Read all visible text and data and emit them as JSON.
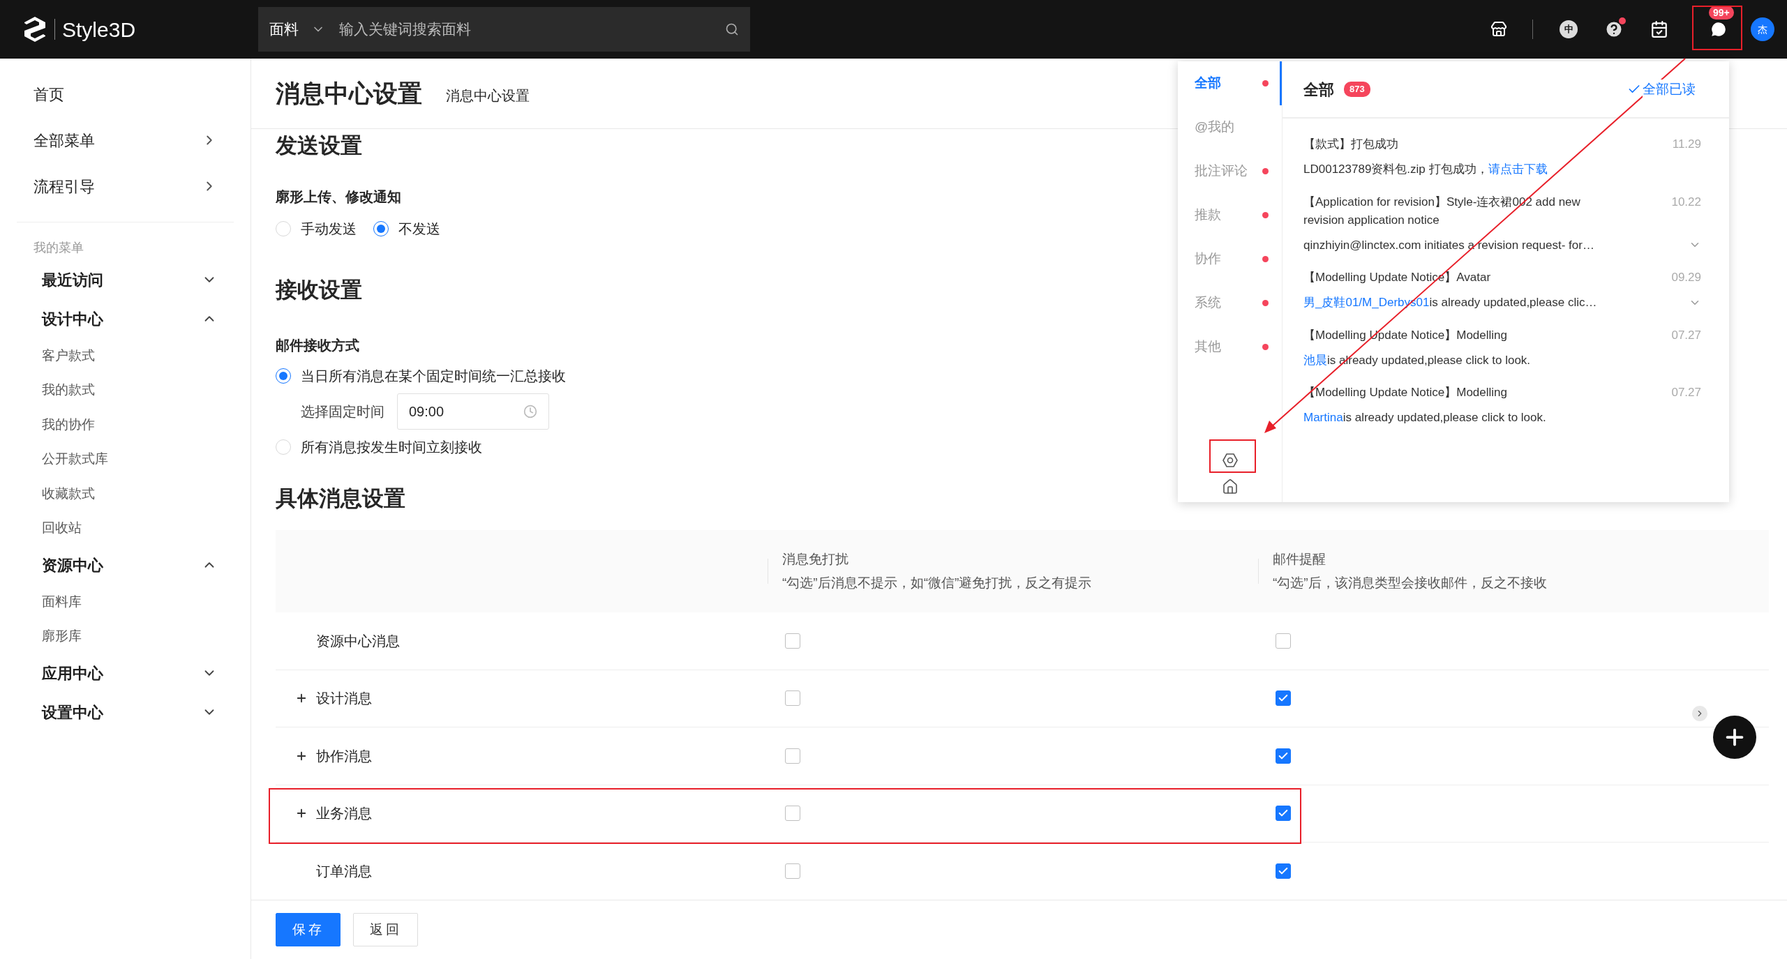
{
  "header": {
    "logo_text": "Style3D",
    "search": {
      "category": "面料",
      "placeholder": "输入关键词搜索面料"
    },
    "language": "中",
    "help_dot": true,
    "message_badge": "99+",
    "avatar": "杰"
  },
  "sidebar": {
    "top_items": [
      {
        "label": "首页",
        "arrow": false
      },
      {
        "label": "全部菜单",
        "arrow": true
      },
      {
        "label": "流程引导",
        "arrow": true
      }
    ],
    "section_label": "我的菜单",
    "groups": [
      {
        "label": "最近访问",
        "expanded": false
      },
      {
        "label": "设计中心",
        "expanded": true,
        "children": [
          "客户款式",
          "我的款式",
          "我的协作",
          "公开款式库",
          "收藏款式",
          "回收站"
        ]
      },
      {
        "label": "资源中心",
        "expanded": true,
        "children": [
          "面料库",
          "廓形库"
        ]
      },
      {
        "label": "应用中心",
        "expanded": false
      },
      {
        "label": "设置中心",
        "expanded": false
      }
    ]
  },
  "page": {
    "title": "消息中心设置",
    "breadcrumb": "消息中心设置"
  },
  "send_settings": {
    "heading": "发送设置",
    "label": "廓形上传、修改通知",
    "options": [
      {
        "label": "手动发送",
        "selected": false
      },
      {
        "label": "不发送",
        "selected": true
      }
    ]
  },
  "receive_settings": {
    "heading": "接收设置",
    "label": "邮件接收方式",
    "options": [
      {
        "label": "当日所有消息在某个固定时间统一汇总接收",
        "selected": true
      },
      {
        "label": "所有消息按发生时间立刻接收",
        "selected": false
      }
    ],
    "time_label": "选择固定时间",
    "time_value": "09:00"
  },
  "message_settings": {
    "heading": "具体消息设置",
    "columns": [
      {
        "title": "消息免打扰",
        "subtitle": "“勾选”后消息不提示，如“微信”避免打扰，反之有提示"
      },
      {
        "title": "邮件提醒",
        "subtitle": "“勾选”后，该消息类型会接收邮件，反之不接收"
      }
    ],
    "rows": [
      {
        "name": "资源中心消息",
        "expandable": false,
        "mute_checked": false,
        "email_checked": false,
        "annotated": false
      },
      {
        "name": "设计消息",
        "expandable": true,
        "mute_checked": false,
        "email_checked": true,
        "annotated": false
      },
      {
        "name": "协作消息",
        "expandable": true,
        "mute_checked": false,
        "email_checked": true,
        "annotated": false
      },
      {
        "name": "业务消息",
        "expandable": true,
        "mute_checked": false,
        "email_checked": true,
        "annotated": true
      },
      {
        "name": "订单消息",
        "expandable": false,
        "mute_checked": false,
        "email_checked": true,
        "annotated": false
      }
    ]
  },
  "footer": {
    "buttons": [
      {
        "label": "保存",
        "kind": "primary"
      },
      {
        "label": "返回",
        "kind": "default"
      }
    ]
  },
  "notifications": {
    "tabs": [
      {
        "label": "全部",
        "selected": true,
        "dot": true
      },
      {
        "label": "@我的",
        "selected": false,
        "dot": false
      },
      {
        "label": "批注评论",
        "selected": false,
        "dot": true
      },
      {
        "label": "推款",
        "selected": false,
        "dot": true
      },
      {
        "label": "协作",
        "selected": false,
        "dot": true
      },
      {
        "label": "系统",
        "selected": false,
        "dot": true
      },
      {
        "label": "其他",
        "selected": false,
        "dot": true
      }
    ],
    "title": "全部",
    "count": "873",
    "mark_all": "全部已读",
    "items": [
      {
        "title": "【款式】打包成功",
        "date": "11.29",
        "expandable": false,
        "body": [
          {
            "text": "LD00123789资料包.zip 打包成功，",
            "link": false
          },
          {
            "text": "请点击下载",
            "link": true
          }
        ]
      },
      {
        "title": "【Application for revision】Style-连衣裙002 add new revision application notice",
        "date": "10.22",
        "expandable": true,
        "body": [
          {
            "text": "qinzhiyin@linctex.com initiates a revision request- for…",
            "link": false
          }
        ]
      },
      {
        "title": "【Modelling Update Notice】Avatar",
        "date": "09.29",
        "expandable": true,
        "body": [
          {
            "text": "男_皮鞋01/M_Derbys01",
            "link": true
          },
          {
            "text": "is already updated,please clic…",
            "link": false
          }
        ]
      },
      {
        "title": "【Modelling Update Notice】Modelling",
        "date": "07.27",
        "expandable": false,
        "body": [
          {
            "text": "池晨",
            "link": true
          },
          {
            "text": "is already updated,please click to look.",
            "link": false
          }
        ]
      },
      {
        "title": "【Modelling Update Notice】Modelling",
        "date": "07.27",
        "expandable": false,
        "body": [
          {
            "text": "Martina",
            "link": true
          },
          {
            "text": "is already updated,please click to look.",
            "link": false
          }
        ]
      }
    ]
  }
}
